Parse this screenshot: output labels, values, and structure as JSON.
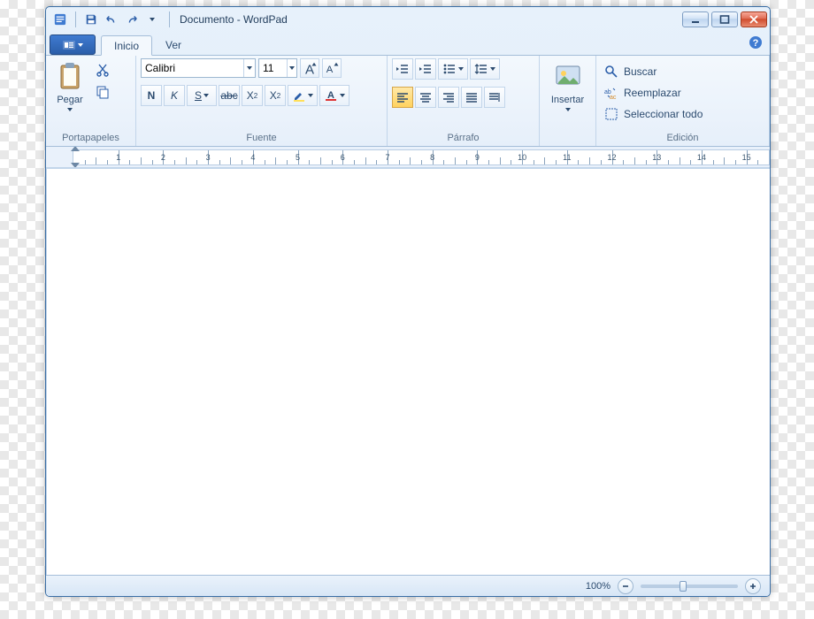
{
  "window": {
    "title": "Documento - WordPad"
  },
  "tabs": {
    "home": "Inicio",
    "view": "Ver"
  },
  "clipboard": {
    "paste": "Pegar",
    "group": "Portapapeles"
  },
  "font": {
    "name": "Calibri",
    "size": "11",
    "group": "Fuente",
    "bold": "N",
    "italic": "K",
    "underline": "S",
    "strike": "abc",
    "sub": "X",
    "sup": "X"
  },
  "paragraph": {
    "group": "Párrafo"
  },
  "insert": {
    "label": "Insertar"
  },
  "editing": {
    "find": "Buscar",
    "replace": "Reemplazar",
    "selectall": "Seleccionar todo",
    "group": "Edición"
  },
  "ruler": {
    "max": 15
  },
  "status": {
    "zoom": "100%"
  }
}
